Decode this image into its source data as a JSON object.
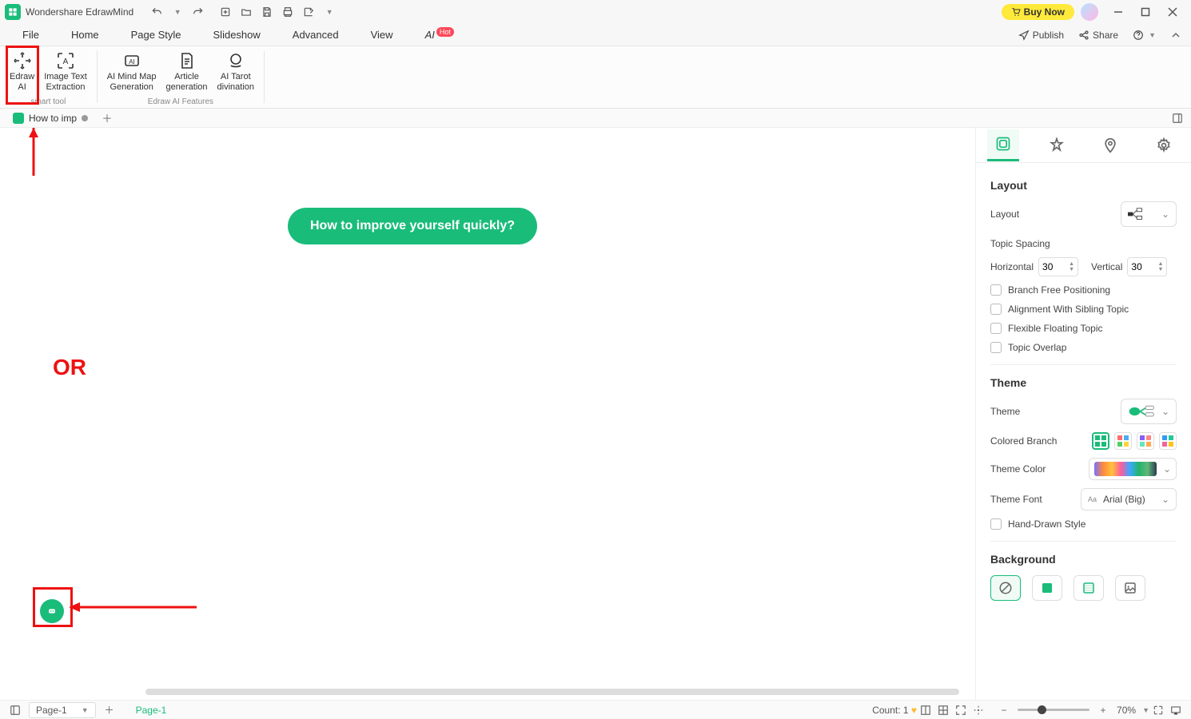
{
  "titlebar": {
    "app_title": "Wondershare EdrawMind",
    "buy_now": "Buy Now"
  },
  "menubar": {
    "items": [
      "File",
      "Home",
      "Page Style",
      "Slideshow",
      "Advanced",
      "View"
    ],
    "ai_label": "AI",
    "hot_label": "Hot",
    "publish": "Publish",
    "share": "Share"
  },
  "ribbon": {
    "group1_label": "smart tool",
    "group2_label": "Edraw AI Features",
    "edraw_ai": "Edraw\nAI",
    "image_text": "Image Text\nExtraction",
    "mm_gen": "AI Mind Map\nGeneration",
    "article_gen": "Article\ngeneration",
    "tarot": "AI Tarot\ndivination"
  },
  "doctabs": {
    "tab1": "How to imp"
  },
  "canvas": {
    "node_text": "How to improve yourself quickly?",
    "or_text": "OR"
  },
  "panel": {
    "layout_h": "Layout",
    "layout_label": "Layout",
    "topic_spacing": "Topic Spacing",
    "horizontal": "Horizontal",
    "vertical": "Vertical",
    "h_val": "30",
    "v_val": "30",
    "branch_free": "Branch Free Positioning",
    "align_sibling": "Alignment With Sibling Topic",
    "flex_float": "Flexible Floating Topic",
    "topic_overlap": "Topic Overlap",
    "theme_h": "Theme",
    "theme_label": "Theme",
    "colored_branch": "Colored Branch",
    "theme_color": "Theme Color",
    "theme_font": "Theme Font",
    "font_value": "Arial (Big)",
    "hand_drawn": "Hand-Drawn Style",
    "background_h": "Background"
  },
  "statusbar": {
    "page_sel": "Page-1",
    "page_active": "Page-1",
    "count_label": "Count: 1",
    "zoom": "70%"
  }
}
